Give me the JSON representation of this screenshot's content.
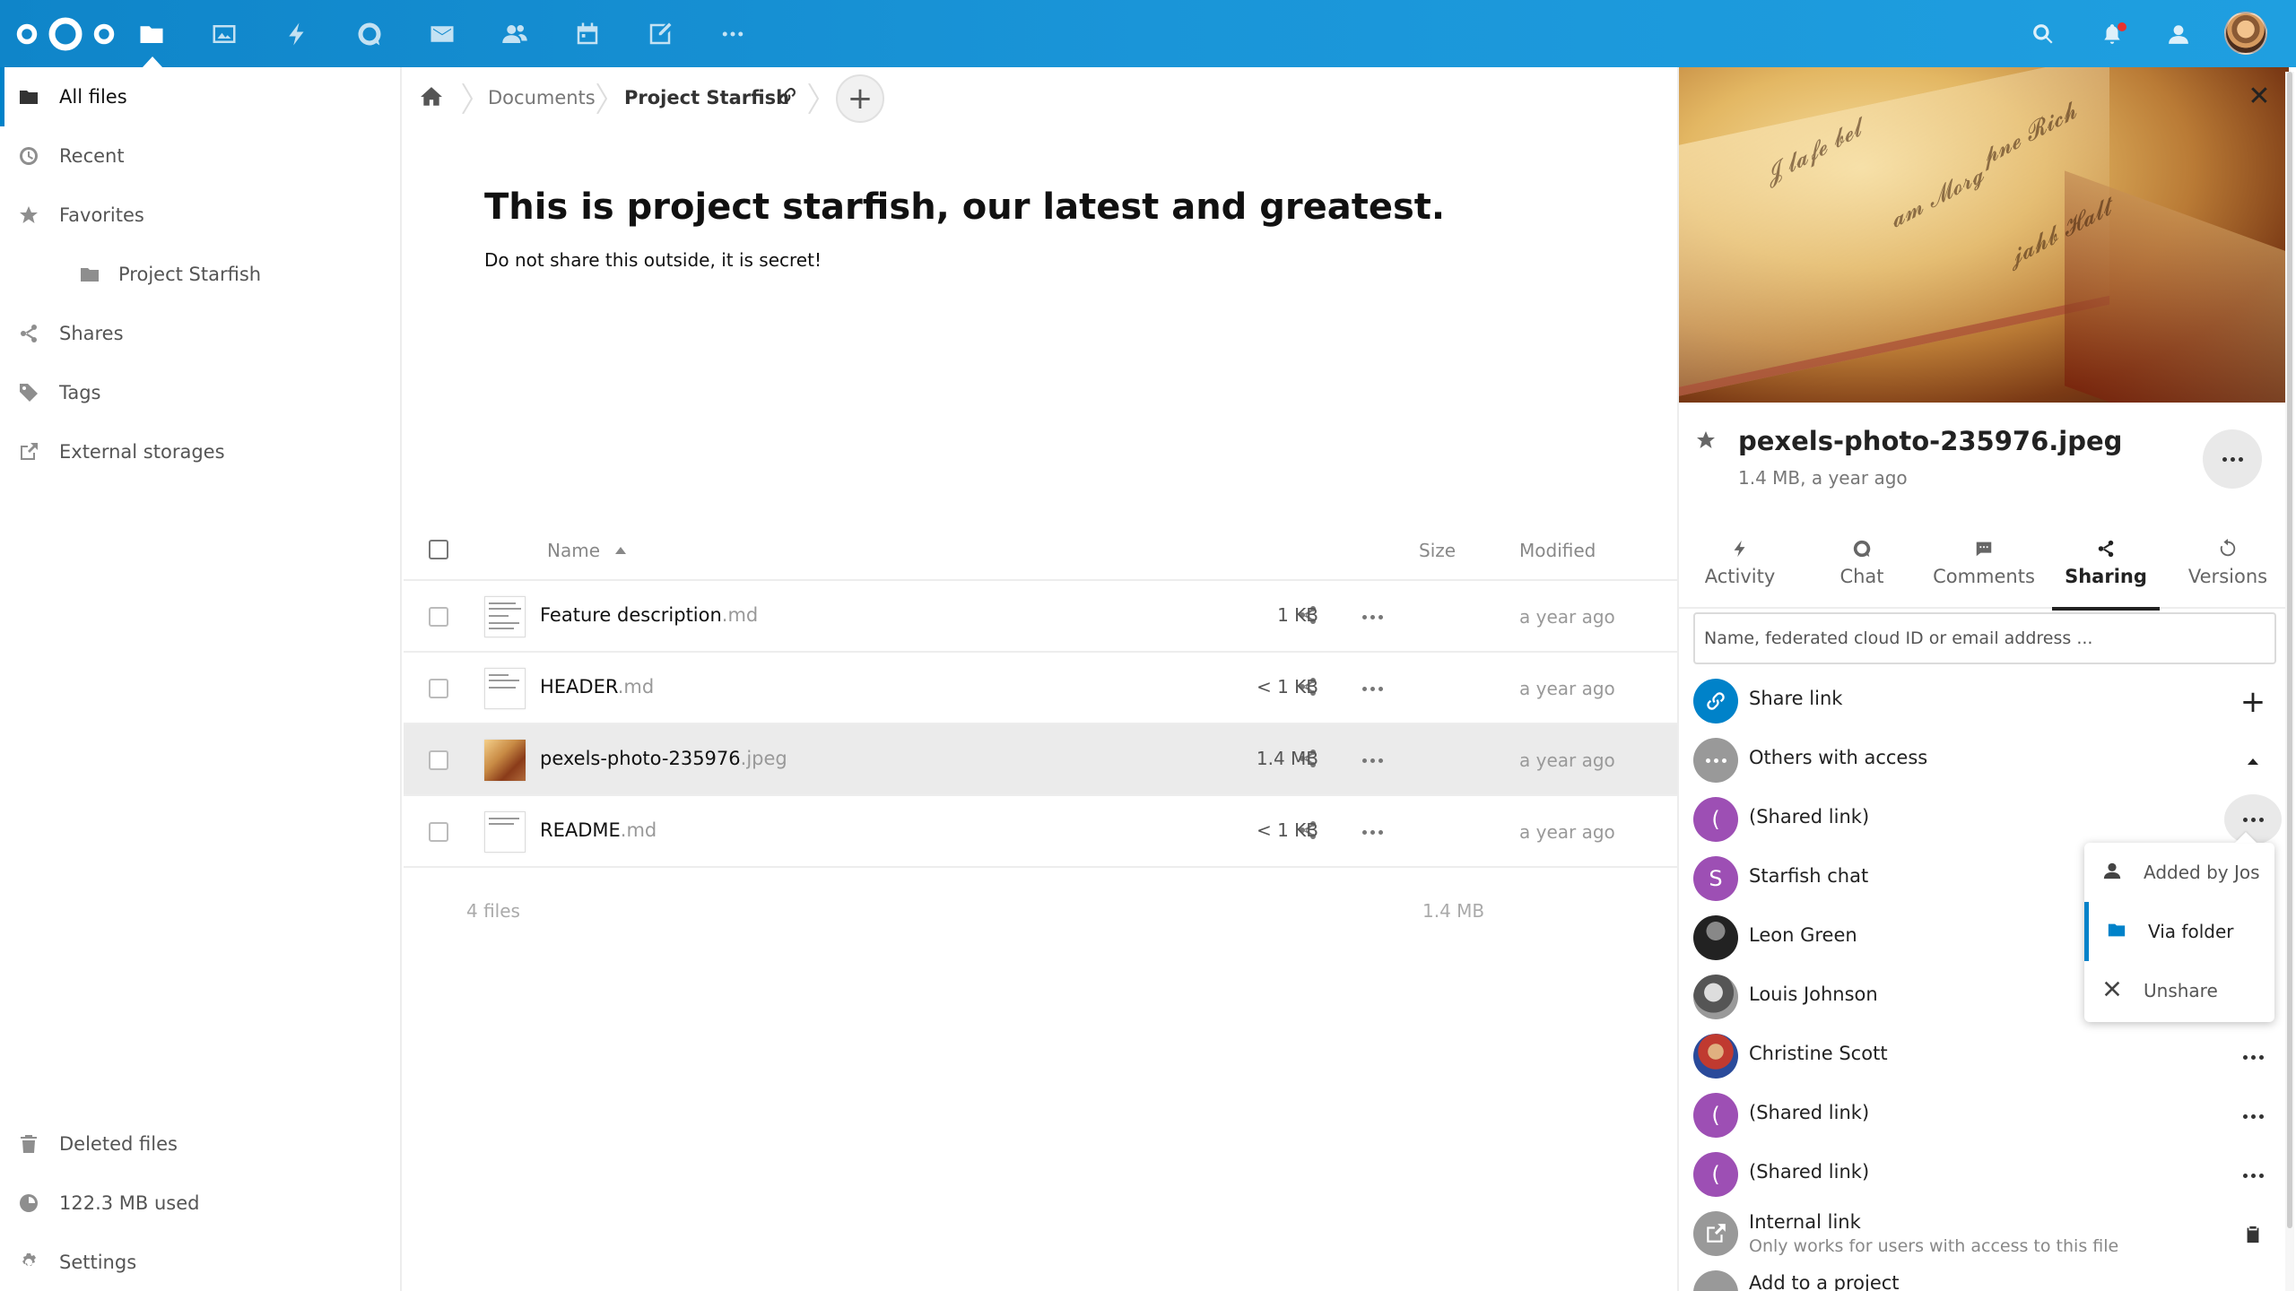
{
  "header": {
    "apps": [
      "files-icon",
      "photos-icon",
      "activity-icon",
      "talk-icon",
      "mail-icon",
      "contacts-icon",
      "calendar-icon",
      "notes-icon",
      "more-apps-icon"
    ],
    "right_icons": [
      "search-icon",
      "notifications-icon",
      "contacts-menu-icon"
    ],
    "accent": "#0082c9"
  },
  "sidebar": {
    "items": [
      {
        "label": "All files",
        "icon": "folder-icon"
      },
      {
        "label": "Recent",
        "icon": "clock-icon"
      },
      {
        "label": "Favorites",
        "icon": "star-icon"
      },
      {
        "label": "Project Starfish",
        "icon": "folder-icon"
      },
      {
        "label": "Shares",
        "icon": "share-icon"
      },
      {
        "label": "Tags",
        "icon": "tag-icon"
      },
      {
        "label": "External storages",
        "icon": "external-icon"
      }
    ],
    "bottom": [
      {
        "label": "Deleted files",
        "icon": "trash-icon"
      },
      {
        "label": "122.3 MB used",
        "icon": "quota-icon"
      },
      {
        "label": "Settings",
        "icon": "gear-icon"
      }
    ]
  },
  "breadcrumb": {
    "items": [
      "Documents",
      "Project Starfish"
    ],
    "add": "+"
  },
  "readme": {
    "title": "This is project starfish, our latest and greatest.",
    "body": "Do not share this outside, it is secret!"
  },
  "files": {
    "columns": {
      "name": "Name",
      "size": "Size",
      "modified": "Modified"
    },
    "rows": [
      {
        "base": "Feature description",
        "ext": ".md",
        "size": "1 KB",
        "modified": "a year ago"
      },
      {
        "base": "HEADER",
        "ext": ".md",
        "size": "< 1 KB",
        "modified": "a year ago"
      },
      {
        "base": "pexels-photo-235976",
        "ext": ".jpeg",
        "size": "1.4 MB",
        "modified": "a year ago"
      },
      {
        "base": "README",
        "ext": ".md",
        "size": "< 1 KB",
        "modified": "a year ago"
      }
    ],
    "summary_count": "4 files",
    "summary_size": "1.4 MB"
  },
  "panel": {
    "close": "✕",
    "filename": "pexels-photo-235976.jpeg",
    "meta": "1.4 MB, a year ago",
    "tabs": [
      {
        "label": "Activity",
        "icon": "activity-icon"
      },
      {
        "label": "Chat",
        "icon": "chat-icon"
      },
      {
        "label": "Comments",
        "icon": "comments-icon"
      },
      {
        "label": "Sharing",
        "icon": "share-icon"
      },
      {
        "label": "Versions",
        "icon": "history-icon"
      }
    ],
    "share_placeholder": "Name, federated cloud ID or email address ...",
    "share_rows": [
      {
        "label": "Share link",
        "avatar": "(",
        "color": "#0082c9"
      },
      {
        "label": "Others with access",
        "avatar": "",
        "color": "#999999"
      },
      {
        "label": "(Shared link)",
        "avatar": "(",
        "color": "#9d4fb4"
      },
      {
        "label": "Starfish chat",
        "avatar": "S",
        "color": "#9d4fb4"
      },
      {
        "label": "Leon Green",
        "avatar": "",
        "color": "#2b2b2b"
      },
      {
        "label": "Louis Johnson",
        "avatar": "",
        "color": "#6b6b6b"
      },
      {
        "label": "Christine Scott",
        "avatar": "",
        "color": "#b04a3a"
      },
      {
        "label": "(Shared link)",
        "avatar": "(",
        "color": "#9d4fb4"
      },
      {
        "label": "(Shared link)",
        "avatar": "(",
        "color": "#9d4fb4"
      }
    ],
    "internal_link": {
      "label": "Internal link",
      "desc": "Only works for users with access to this file"
    },
    "add_project": "Add to a project",
    "popover": [
      {
        "label": "Added by Jos",
        "icon": "user-icon"
      },
      {
        "label": "Via folder",
        "icon": "folder-icon"
      },
      {
        "label": "Unshare",
        "icon": "close-icon"
      }
    ]
  }
}
